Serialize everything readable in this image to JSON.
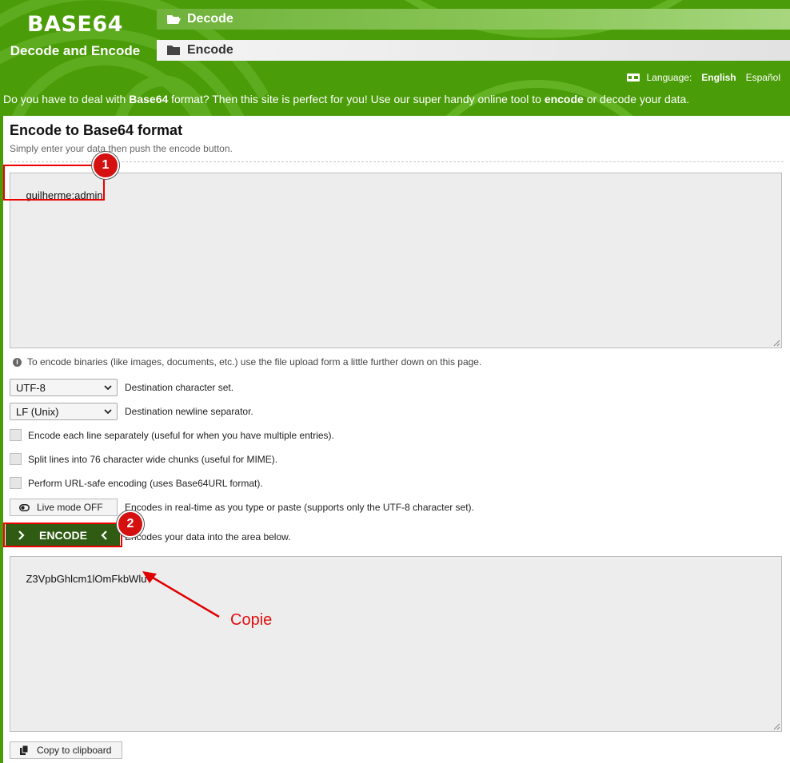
{
  "header": {
    "logo_title": "BASE64",
    "logo_subtitle": "Decode and Encode",
    "nav": [
      {
        "label": "Decode",
        "icon": "folder-open-icon"
      },
      {
        "label": "Encode",
        "icon": "folder-icon"
      }
    ],
    "language_label": "Language:",
    "languages": [
      "English",
      "Español"
    ],
    "active_language": "English",
    "tagline": {
      "t1": "Do you have to deal with ",
      "b1": "Base64",
      "t2": " format? Then this site is perfect for you! Use our super handy online tool to ",
      "b2": "encode",
      "t3": " or decode your data."
    }
  },
  "main": {
    "title": "Encode to Base64 format",
    "subtitle": "Simply enter your data then push the encode button.",
    "input_value": "guilherme:admin",
    "info_text": "To encode binaries (like images, documents, etc.) use the file upload form a little further down on this page.",
    "charset": {
      "value": "UTF-8",
      "label": "Destination character set."
    },
    "newline": {
      "value": "LF (Unix)",
      "label": "Destination newline separator."
    },
    "checkboxes": [
      {
        "label": "Encode each line separately (useful for when you have multiple entries).",
        "checked": false
      },
      {
        "label": "Split lines into 76 character wide chunks (useful for MIME).",
        "checked": false
      },
      {
        "label": "Perform URL-safe encoding (uses Base64URL format).",
        "checked": false
      }
    ],
    "live_mode": {
      "label": "Live mode OFF",
      "desc": "Encodes in real-time as you type or paste (supports only the UTF-8 character set)."
    },
    "encode_button": {
      "label": "ENCODE",
      "desc": "Encodes your data into the area below."
    },
    "output_value": "Z3VpbGhlcm1lOmFkbWlu",
    "copy_button": "Copy to clipboard"
  },
  "annotations": {
    "badge1": "1",
    "badge2": "2",
    "arrow_text": "Copie",
    "color": "#e00000"
  },
  "colors": {
    "brand_green": "#4b9c09",
    "encode_button": "#2f5b12"
  }
}
